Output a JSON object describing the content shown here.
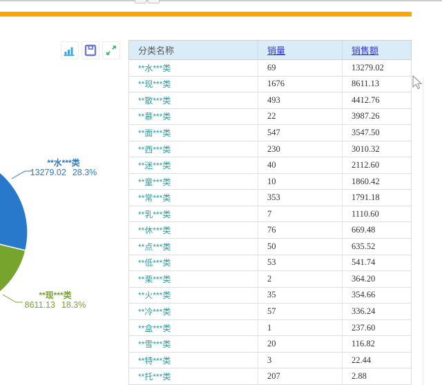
{
  "window": {
    "accent_bar_color": "#FFA500",
    "top_tab_count": 2
  },
  "toolbar": {
    "buttons": [
      {
        "name": "bar-chart",
        "color": "#41A6DD"
      },
      {
        "name": "save",
        "color": "#6B79D6"
      },
      {
        "name": "expand",
        "color": "#33B264"
      }
    ]
  },
  "pie": {
    "slices": [
      {
        "label": "**水***类",
        "value": "13279.02",
        "percent": "28.3%",
        "color": "#2878CC"
      },
      {
        "label": "**现***类",
        "value": "8611.13",
        "percent": "18.3%",
        "color": "#76A42D"
      }
    ]
  },
  "chart_data": {
    "type": "pie",
    "title": "",
    "categories": [
      "**水***类",
      "**现***类"
    ],
    "values": [
      13279.02,
      8611.13
    ],
    "percents": [
      28.3,
      18.3
    ],
    "colors": [
      "#2878CC",
      "#76A42D"
    ],
    "legend_position": "none"
  },
  "table": {
    "headers": [
      {
        "label": "分类名称",
        "link": false
      },
      {
        "label": "销量",
        "link": true
      },
      {
        "label": "销售额",
        "link": true
      }
    ],
    "rows": [
      {
        "category": "**水***类",
        "qty": "69",
        "amount": "13279.02"
      },
      {
        "category": "**现***类",
        "qty": "1676",
        "amount": "8611.13"
      },
      {
        "category": "**散***类",
        "qty": "493",
        "amount": "4412.76"
      },
      {
        "category": "**慕***类",
        "qty": "22",
        "amount": "3987.26"
      },
      {
        "category": "**面***类",
        "qty": "547",
        "amount": "3547.50"
      },
      {
        "category": "**西***类",
        "qty": "230",
        "amount": "3010.32"
      },
      {
        "category": "**迷***类",
        "qty": "40",
        "amount": "2112.60"
      },
      {
        "category": "**童***类",
        "qty": "10",
        "amount": "1860.42"
      },
      {
        "category": "**常***类",
        "qty": "353",
        "amount": "1791.18"
      },
      {
        "category": "**乳***类",
        "qty": "7",
        "amount": "1110.60"
      },
      {
        "category": "**休***类",
        "qty": "76",
        "amount": "669.48"
      },
      {
        "category": "**点***类",
        "qty": "50",
        "amount": "635.52"
      },
      {
        "category": "**低***类",
        "qty": "53",
        "amount": "541.74"
      },
      {
        "category": "**栗***类",
        "qty": "2",
        "amount": "364.20"
      },
      {
        "category": "**火***类",
        "qty": "35",
        "amount": "354.66"
      },
      {
        "category": "**冷***类",
        "qty": "57",
        "amount": "336.24"
      },
      {
        "category": "**盒***类",
        "qty": "1",
        "amount": "237.60"
      },
      {
        "category": "**雪***类",
        "qty": "20",
        "amount": "116.82"
      },
      {
        "category": "**特***类",
        "qty": "3",
        "amount": "22.44"
      },
      {
        "category": "**托***类",
        "qty": "207",
        "amount": "2.88"
      }
    ]
  }
}
